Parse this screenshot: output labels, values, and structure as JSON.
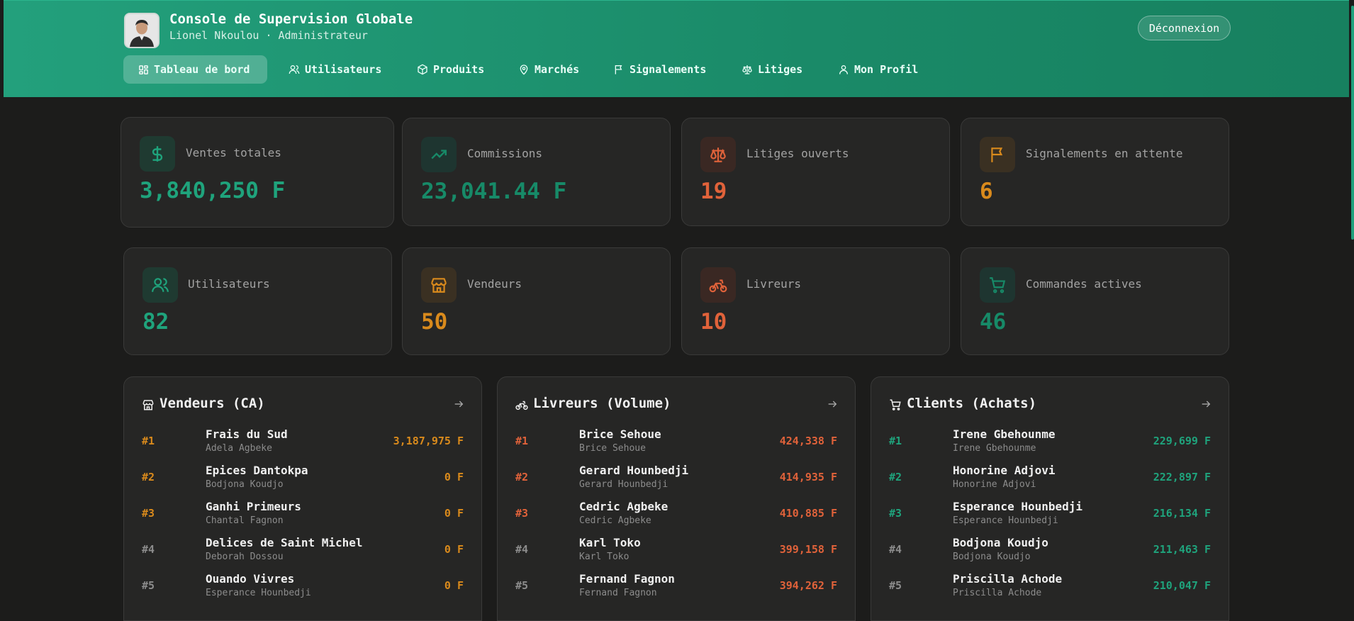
{
  "header": {
    "title": "Console de Supervision Globale",
    "subtitle": "Lionel Nkoulou · Administrateur",
    "logout_label": "Déconnexion"
  },
  "nav": [
    {
      "label": "Tableau de bord",
      "icon": "dashboard-icon",
      "active": true
    },
    {
      "label": "Utilisateurs",
      "icon": "users-icon"
    },
    {
      "label": "Produits",
      "icon": "box-icon"
    },
    {
      "label": "Marchés",
      "icon": "map-pin-icon"
    },
    {
      "label": "Signalements",
      "icon": "flag-icon"
    },
    {
      "label": "Litiges",
      "icon": "scale-icon"
    },
    {
      "label": "Mon Profil",
      "icon": "user-icon"
    }
  ],
  "stats": [
    {
      "label": "Ventes totales",
      "value": "3,840,250 F",
      "icon": "dollar-icon",
      "color": "#1fa37c"
    },
    {
      "label": "Commissions",
      "value": "23,041.44 F",
      "icon": "trending-up-icon",
      "color": "#178a68"
    },
    {
      "label": "Litiges ouverts",
      "value": "19",
      "icon": "scale-icon",
      "color": "#e0623a"
    },
    {
      "label": "Signalements en attente",
      "value": "6",
      "icon": "flag-icon",
      "color": "#d98a1c"
    },
    {
      "label": "Utilisateurs",
      "value": "82",
      "icon": "users-icon",
      "color": "#1fa37c"
    },
    {
      "label": "Vendeurs",
      "value": "50",
      "icon": "store-icon",
      "color": "#d98a1c"
    },
    {
      "label": "Livreurs",
      "value": "10",
      "icon": "bike-icon",
      "color": "#e0623a"
    },
    {
      "label": "Commandes actives",
      "value": "46",
      "icon": "cart-icon",
      "color": "#178a68"
    }
  ],
  "lists": [
    {
      "title": "Vendeurs (CA)",
      "icon": "store-icon",
      "accent": "#d98a1c",
      "rows": [
        {
          "rank": "#1",
          "name": "Frais du Sud",
          "sub": "Adela Agbeke",
          "amount": "3,187,975 F"
        },
        {
          "rank": "#2",
          "name": "Epices Dantokpa",
          "sub": "Bodjona Koudjo",
          "amount": "0 F"
        },
        {
          "rank": "#3",
          "name": "Ganhi Primeurs",
          "sub": "Chantal Fagnon",
          "amount": "0 F"
        },
        {
          "rank": "#4",
          "name": "Delices de Saint Michel",
          "sub": "Deborah Dossou",
          "amount": "0 F"
        },
        {
          "rank": "#5",
          "name": "Ouando Vivres",
          "sub": "Esperance Hounbedji",
          "amount": "0 F"
        }
      ]
    },
    {
      "title": "Livreurs (Volume)",
      "icon": "bike-icon",
      "accent": "#e0623a",
      "rows": [
        {
          "rank": "#1",
          "name": "Brice Sehoue",
          "sub": "Brice Sehoue",
          "amount": "424,338 F"
        },
        {
          "rank": "#2",
          "name": "Gerard Hounbedji",
          "sub": "Gerard Hounbedji",
          "amount": "414,935 F"
        },
        {
          "rank": "#3",
          "name": "Cedric Agbeke",
          "sub": "Cedric Agbeke",
          "amount": "410,885 F"
        },
        {
          "rank": "#4",
          "name": "Karl Toko",
          "sub": "Karl Toko",
          "amount": "399,158 F"
        },
        {
          "rank": "#5",
          "name": "Fernand Fagnon",
          "sub": "Fernand Fagnon",
          "amount": "394,262 F"
        }
      ]
    },
    {
      "title": "Clients (Achats)",
      "icon": "cart-icon",
      "accent": "#1fa37c",
      "rows": [
        {
          "rank": "#1",
          "name": "Irene Gbehounme",
          "sub": "Irene Gbehounme",
          "amount": "229,699 F"
        },
        {
          "rank": "#2",
          "name": "Honorine Adjovi",
          "sub": "Honorine Adjovi",
          "amount": "222,897 F"
        },
        {
          "rank": "#3",
          "name": "Esperance Hounbedji",
          "sub": "Esperance Hounbedji",
          "amount": "216,134 F"
        },
        {
          "rank": "#4",
          "name": "Bodjona Koudjo",
          "sub": "Bodjona Koudjo",
          "amount": "211,463 F"
        },
        {
          "rank": "#5",
          "name": "Priscilla Achode",
          "sub": "Priscilla Achode",
          "amount": "210,047 F"
        }
      ]
    }
  ]
}
